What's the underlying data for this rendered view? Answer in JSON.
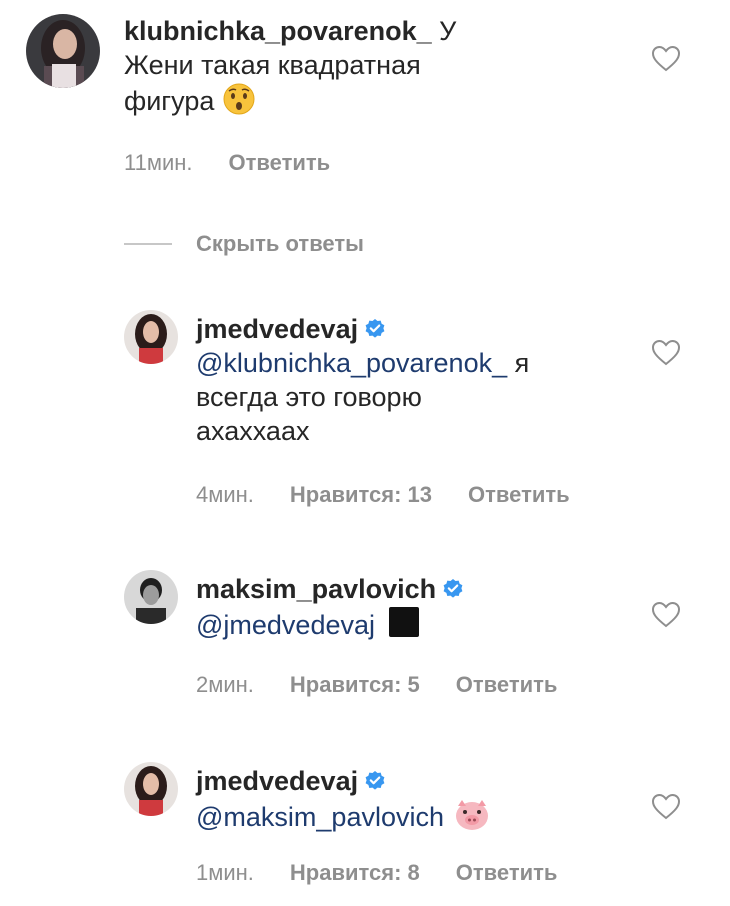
{
  "comments": [
    {
      "username": "klubnichka_povarenok_",
      "text_after_username": "У",
      "text_lines": [
        "Жени такая квадратная",
        "фигура"
      ],
      "emoji": "hushed-face",
      "time": "11мин.",
      "reply_label": "Ответить"
    },
    {
      "username": "jmedvedevaj",
      "verified": true,
      "mention": "@klubnichka_povarenok_",
      "text_after_mention": "я",
      "text_lines": [
        "всегда это говорю",
        "ахаххаах"
      ],
      "time": "4мин.",
      "likes": "Нравится: 13",
      "reply_label": "Ответить"
    },
    {
      "username": "maksim_pavlovich",
      "verified": true,
      "mention": "@jmedvedevaj",
      "emoji": "black-square",
      "time": "2мин.",
      "likes": "Нравится: 5",
      "reply_label": "Ответить"
    },
    {
      "username": "jmedvedevaj",
      "verified": true,
      "mention": "@maksim_pavlovich",
      "emoji": "pig-face",
      "time": "1мин.",
      "likes": "Нравится: 8",
      "reply_label": "Ответить"
    }
  ],
  "hide_replies_label": "Скрыть ответы",
  "colors": {
    "text": "#262626",
    "meta": "#8e8e8e",
    "mention": "#1e3b6e",
    "verified": "#3897f0"
  }
}
